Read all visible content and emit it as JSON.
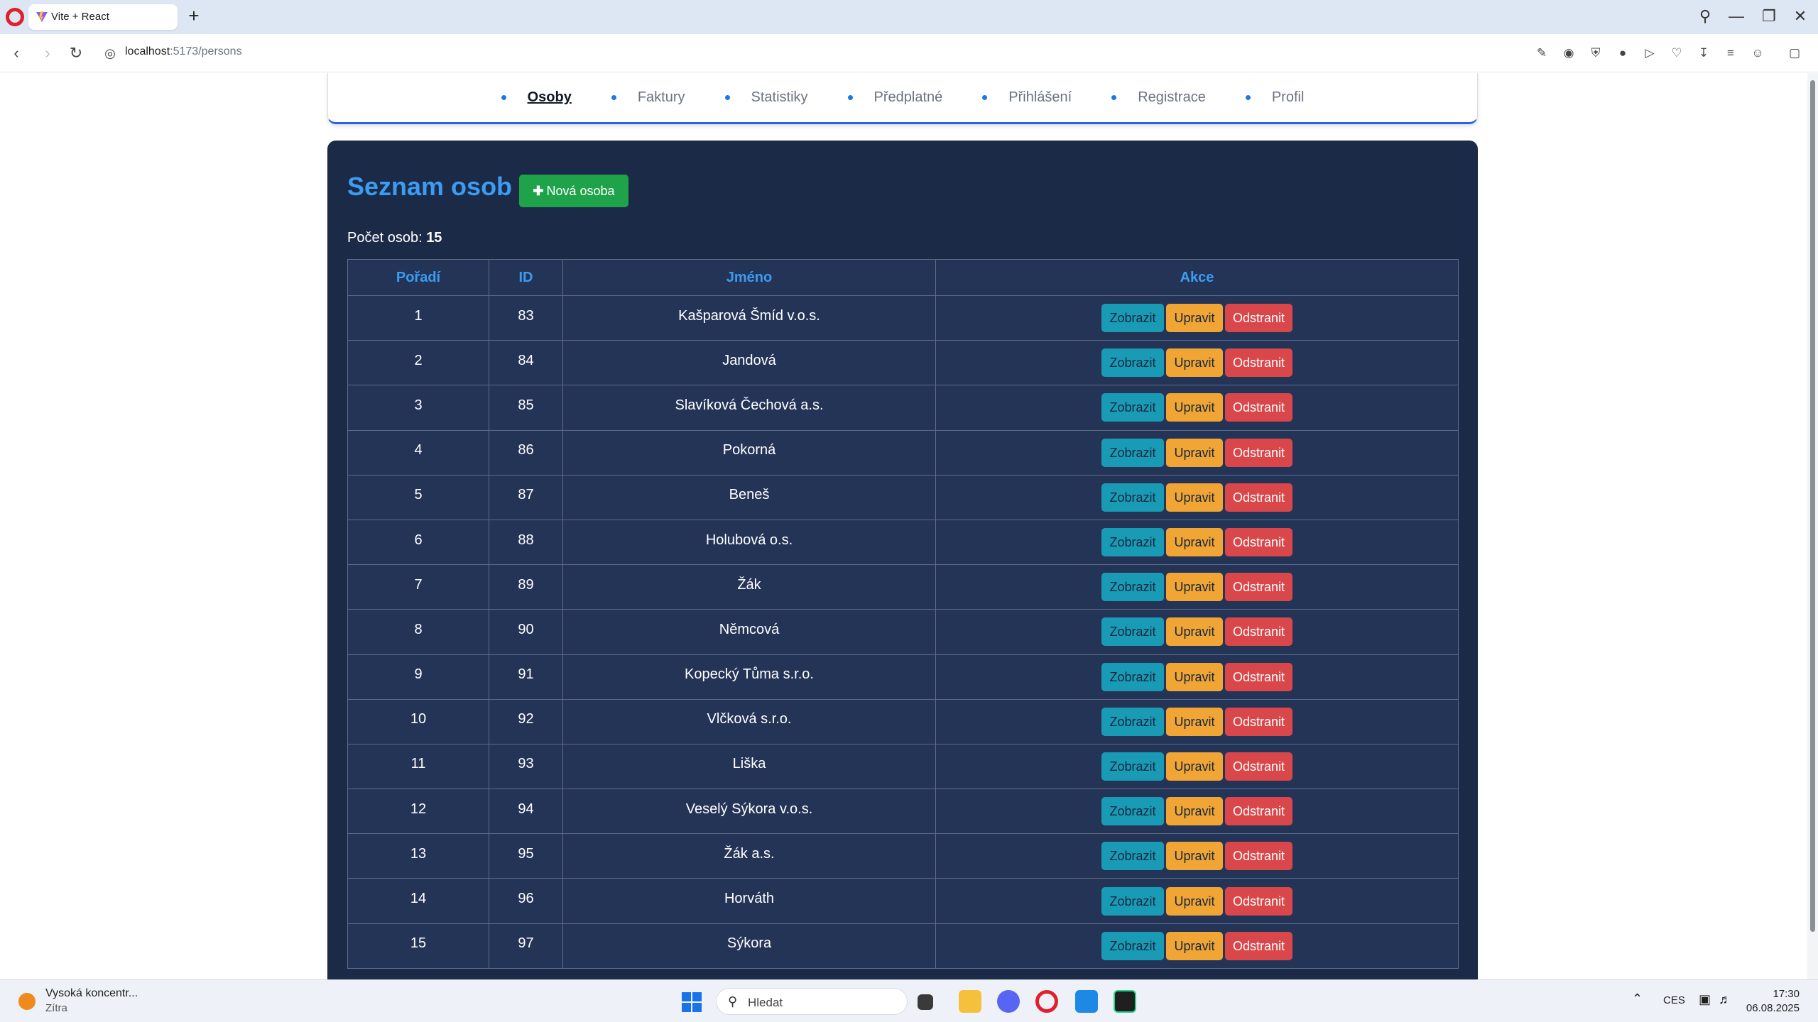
{
  "browser": {
    "tab_title": "Vite + React",
    "new_tab_symbol": "+",
    "url_host": "localhost",
    "url_rest": ":5173/persons",
    "accent": "#e0202c"
  },
  "nav": {
    "items": [
      "Osoby",
      "Faktury",
      "Statistiky",
      "Předplatné",
      "Přihlášení",
      "Registrace",
      "Profil"
    ],
    "active": "Osoby"
  },
  "page": {
    "title": "Seznam osob",
    "new_button_label": "Nová osoba",
    "count_label": "Počet osob:",
    "count_value": "15",
    "columns": [
      "Pořadí",
      "ID",
      "Jméno",
      "Akce"
    ],
    "action_labels": {
      "show": "Zobrazit",
      "edit": "Upravit",
      "delete": "Odstranit"
    },
    "rows": [
      {
        "order": "1",
        "id": "83",
        "name": "Kašparová Šmíd v.o.s."
      },
      {
        "order": "2",
        "id": "84",
        "name": "Jandová"
      },
      {
        "order": "3",
        "id": "85",
        "name": "Slavíková Čechová a.s."
      },
      {
        "order": "4",
        "id": "86",
        "name": "Pokorná"
      },
      {
        "order": "5",
        "id": "87",
        "name": "Beneš"
      },
      {
        "order": "6",
        "id": "88",
        "name": "Holubová o.s."
      },
      {
        "order": "7",
        "id": "89",
        "name": "Žák"
      },
      {
        "order": "8",
        "id": "90",
        "name": "Němcová"
      },
      {
        "order": "9",
        "id": "91",
        "name": "Kopecký Tůma s.r.o."
      },
      {
        "order": "10",
        "id": "92",
        "name": "Vlčková s.r.o."
      },
      {
        "order": "11",
        "id": "93",
        "name": "Liška"
      },
      {
        "order": "12",
        "id": "94",
        "name": "Veselý Sýkora v.o.s."
      },
      {
        "order": "13",
        "id": "95",
        "name": "Žák a.s."
      },
      {
        "order": "14",
        "id": "96",
        "name": "Horváth"
      },
      {
        "order": "15",
        "id": "97",
        "name": "Sýkora"
      }
    ],
    "colors": {
      "panel_bg": "#1b2a47",
      "title": "#3b9cf2",
      "new_button": "#1fa34a",
      "show_button": "#1a9bb5",
      "edit_button": "#f0a534",
      "delete_button": "#d9474a"
    }
  },
  "taskbar": {
    "weather_title": "Vysoká koncentr...",
    "weather_sub": "Zítra",
    "search_placeholder": "Hledat",
    "language": "CES",
    "time": "17:30",
    "date": "06.08.2025"
  }
}
